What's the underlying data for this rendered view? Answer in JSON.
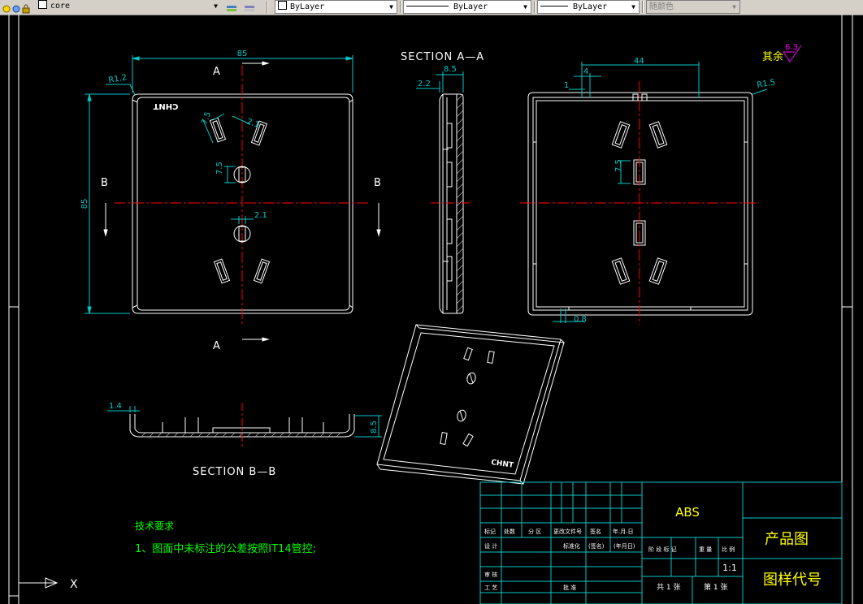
{
  "toolbar": {
    "layer_value": "core",
    "color_value": "ByLayer",
    "linetype_value": "ByLayer",
    "lineweight_value": "ByLayer",
    "plotstyle_value": "随颜色"
  },
  "colors": {
    "background": "#000000",
    "dimension": "#00c8c8",
    "outline": "#ffffff",
    "centerline": "#ff0000",
    "title_block": "#00c8c8",
    "note_text": "#00ff00",
    "title_text": "#ffff00",
    "roughness": "#ff00ff"
  },
  "drawing": {
    "front_view": {
      "width_dim": "85",
      "height_dim": "85",
      "corner_radius": "R1.2",
      "cut_label_top": "A",
      "cut_label_bottom": "A",
      "cut_label_left": "B",
      "cut_label_right": "B",
      "slot_dim_a": "7.5",
      "slot_dim_b": "2.1",
      "round_slot_dim": "7.5",
      "center_dim": "2.1",
      "logo_text": "CHNT"
    },
    "section_aa": {
      "title": "SECTION A—A",
      "thickness_dim": "8.5",
      "wall_dim": "2.2"
    },
    "back_view": {
      "span_dim": "44",
      "small_dim": "4",
      "rib_dim": "1",
      "corner_radius": "R1.5",
      "slot_dim": "7.5",
      "bottom_dim": "0.8"
    },
    "roughness": {
      "label": "其余",
      "value": "6.3"
    },
    "section_bb": {
      "title": "SECTION B—B",
      "wall_dim": "1.4",
      "height_dim": "8.5"
    },
    "iso_view": {
      "logo_text": "CHNT"
    },
    "notes": {
      "heading": "技术要求",
      "line1": "1、图面中未标注的公差按照IT14管控;"
    },
    "ucs": {
      "x_label": "X"
    }
  },
  "title_block": {
    "material": "ABS",
    "product_name": "产品图",
    "drawing_code_label": "图样代号",
    "scale": "1:1",
    "headers_row": [
      "标记",
      "处数",
      "分 区",
      "更改文件号",
      "签名",
      "年.月.日"
    ],
    "design_label": "设 计",
    "standardize_label": "标准化",
    "signature_label": "(签名)",
    "date_label": "(年月日)",
    "stage_label": "阶 段 标 记",
    "weight_label": "重 量",
    "ratio_label": "比 例",
    "review_label": "审 核",
    "process_label": "工 艺",
    "approve_label": "批 准",
    "sheets_total": "共 1 张",
    "sheet_no": "第 1 张"
  }
}
